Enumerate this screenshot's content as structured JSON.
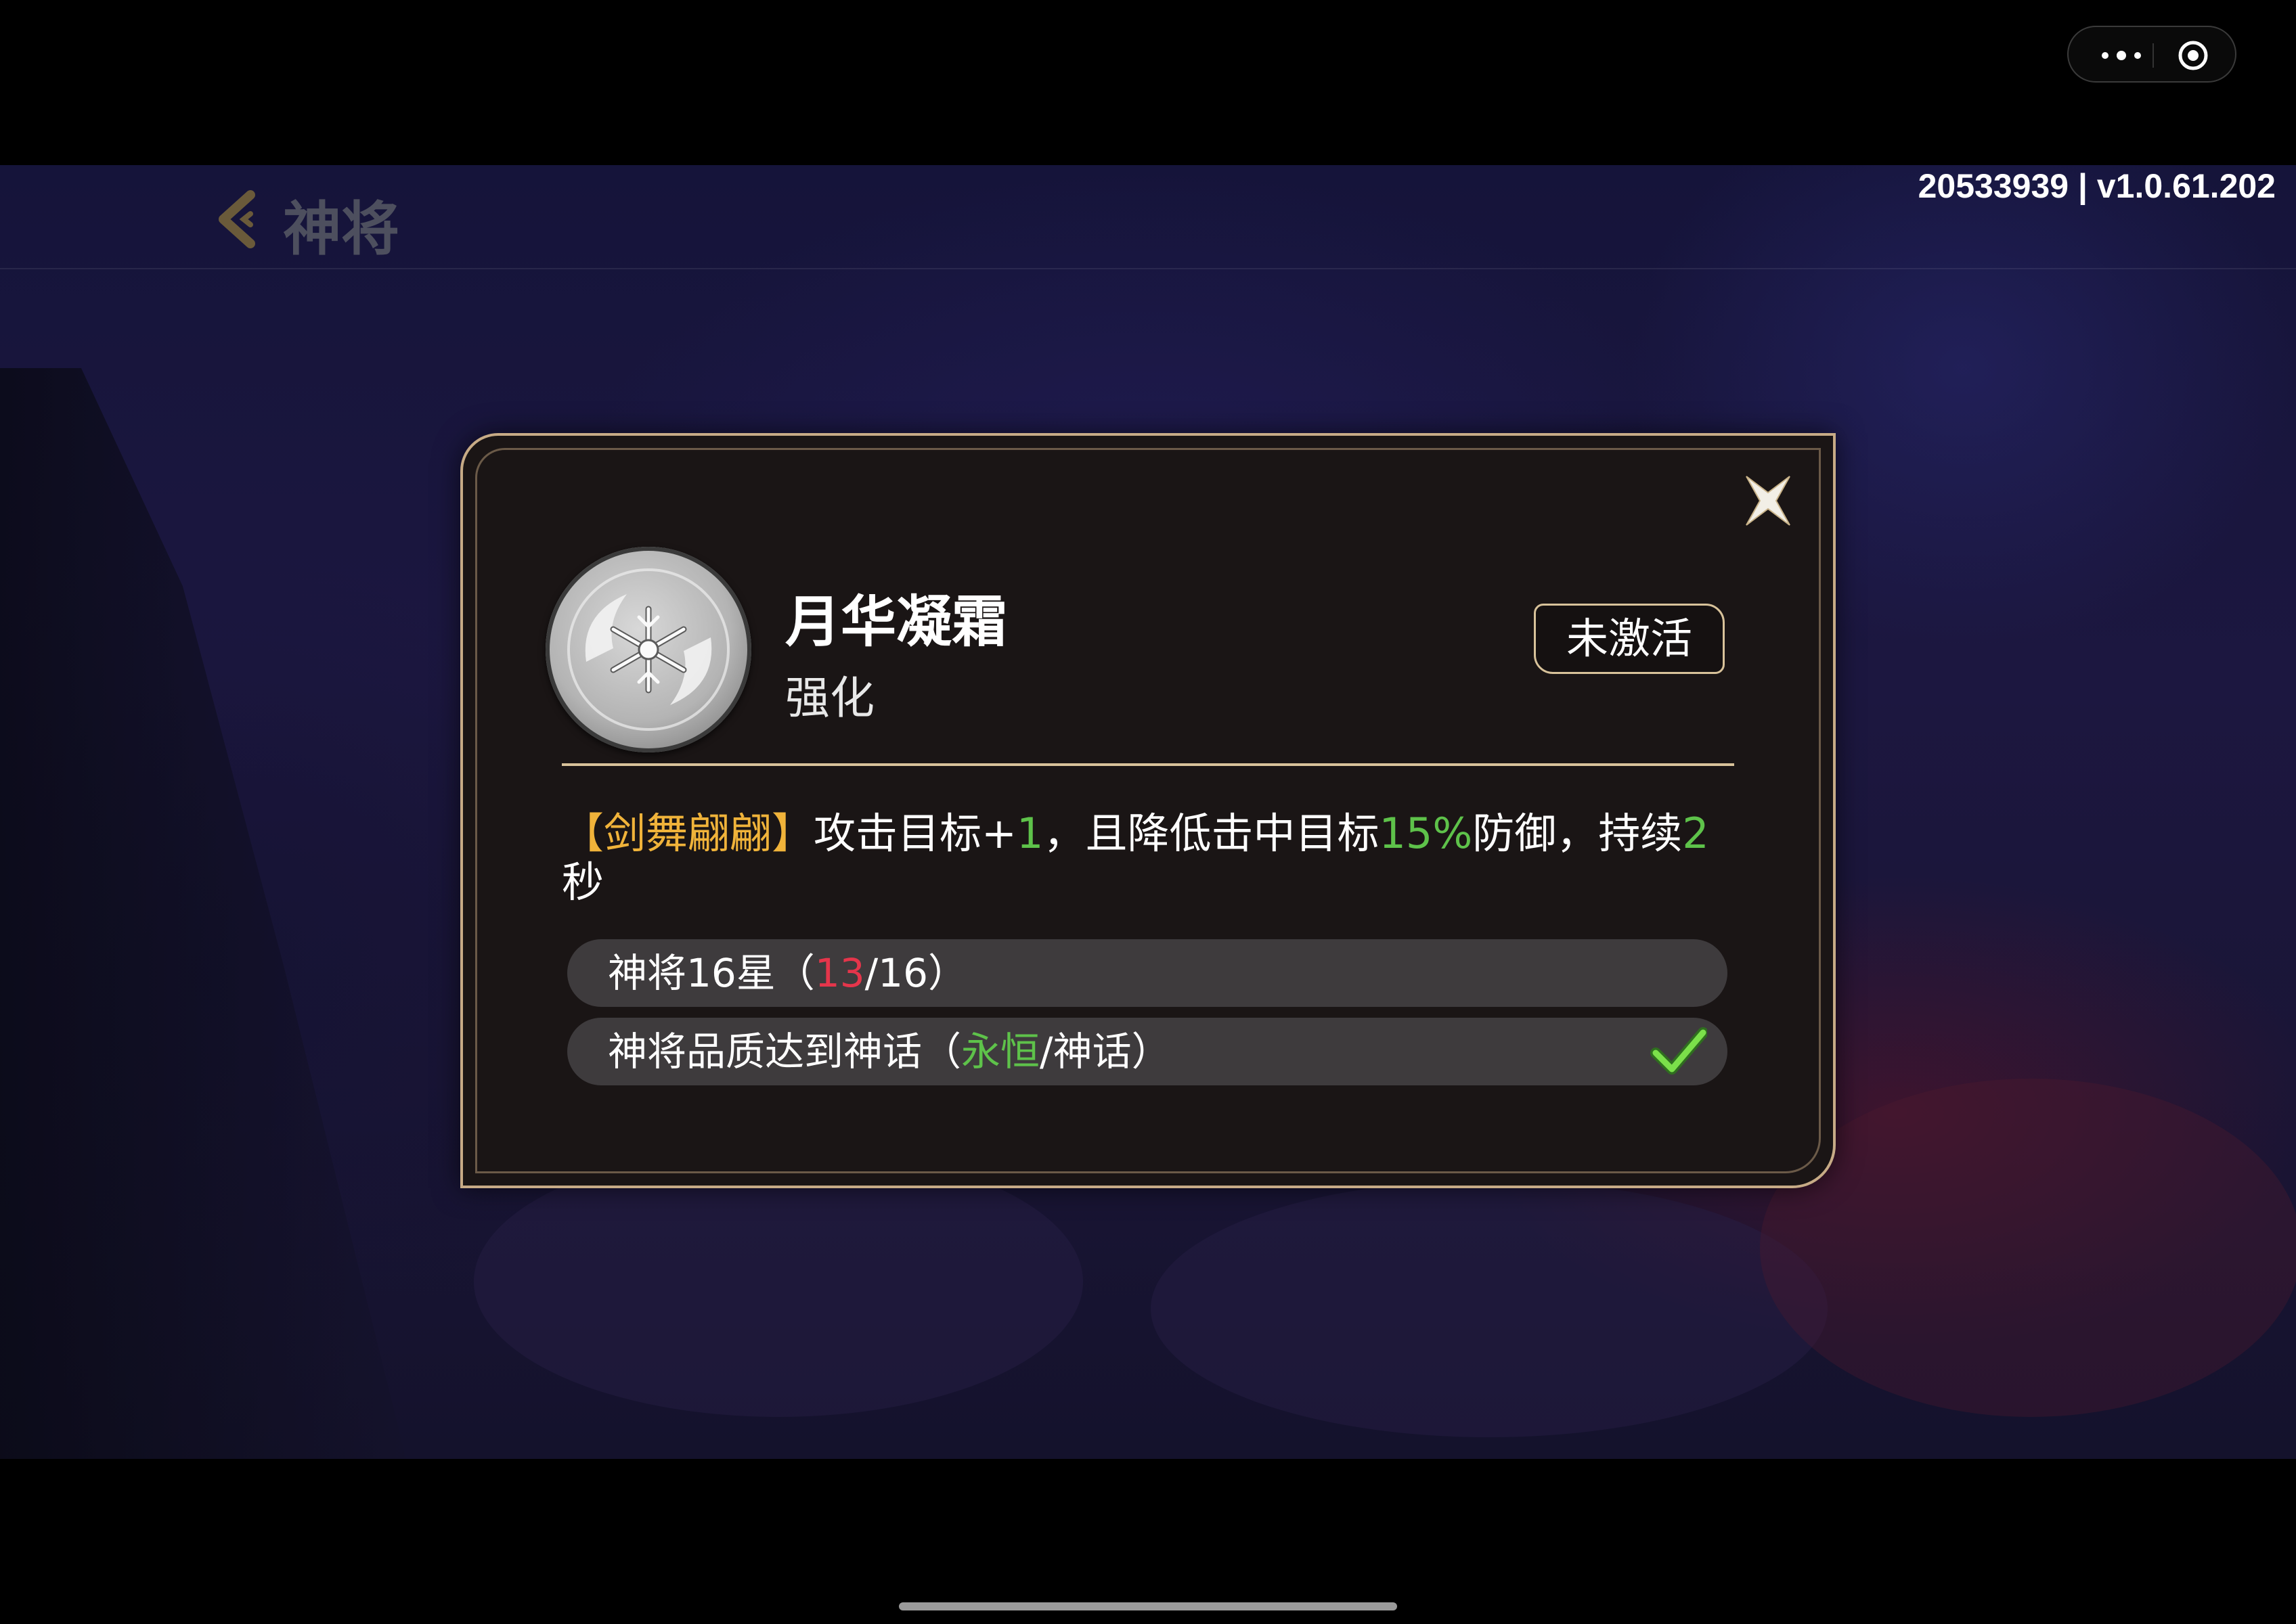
{
  "top_bar": {
    "menu_icon": "more-dots-icon",
    "record_icon": "record-target-icon"
  },
  "build_info": "20533939 | v1.0.61.202",
  "header": {
    "back_icon": "chevron-left-icon",
    "title": "神将"
  },
  "modal": {
    "close_icon": "close-x-icon",
    "emblem_icon": "snowflake-emblem-icon",
    "skill_name": "月华凝霜",
    "skill_type": "强化",
    "status": "未激活",
    "description": {
      "bracket_open": "【",
      "buff_name": "剑舞翩翩",
      "bracket_close": "】",
      "part1": "攻击目标+",
      "target_count": "1",
      "part2": "，且降低击中目标",
      "defense_reduction": "15%",
      "part3": "防御，持续",
      "duration": "2",
      "part4": "秒"
    },
    "conditions": [
      {
        "prefix": "神将16星（",
        "current": "13",
        "suffix": "/16）",
        "met": false
      },
      {
        "prefix": "神将品质达到神话（",
        "current": "永恒",
        "suffix": "/神话）",
        "met": true,
        "check_icon": "checkmark-icon"
      }
    ]
  },
  "colors": {
    "gold": "#f0b33a",
    "green": "#5ec24a",
    "red": "#e5354b",
    "frame": "#c7ab86"
  }
}
